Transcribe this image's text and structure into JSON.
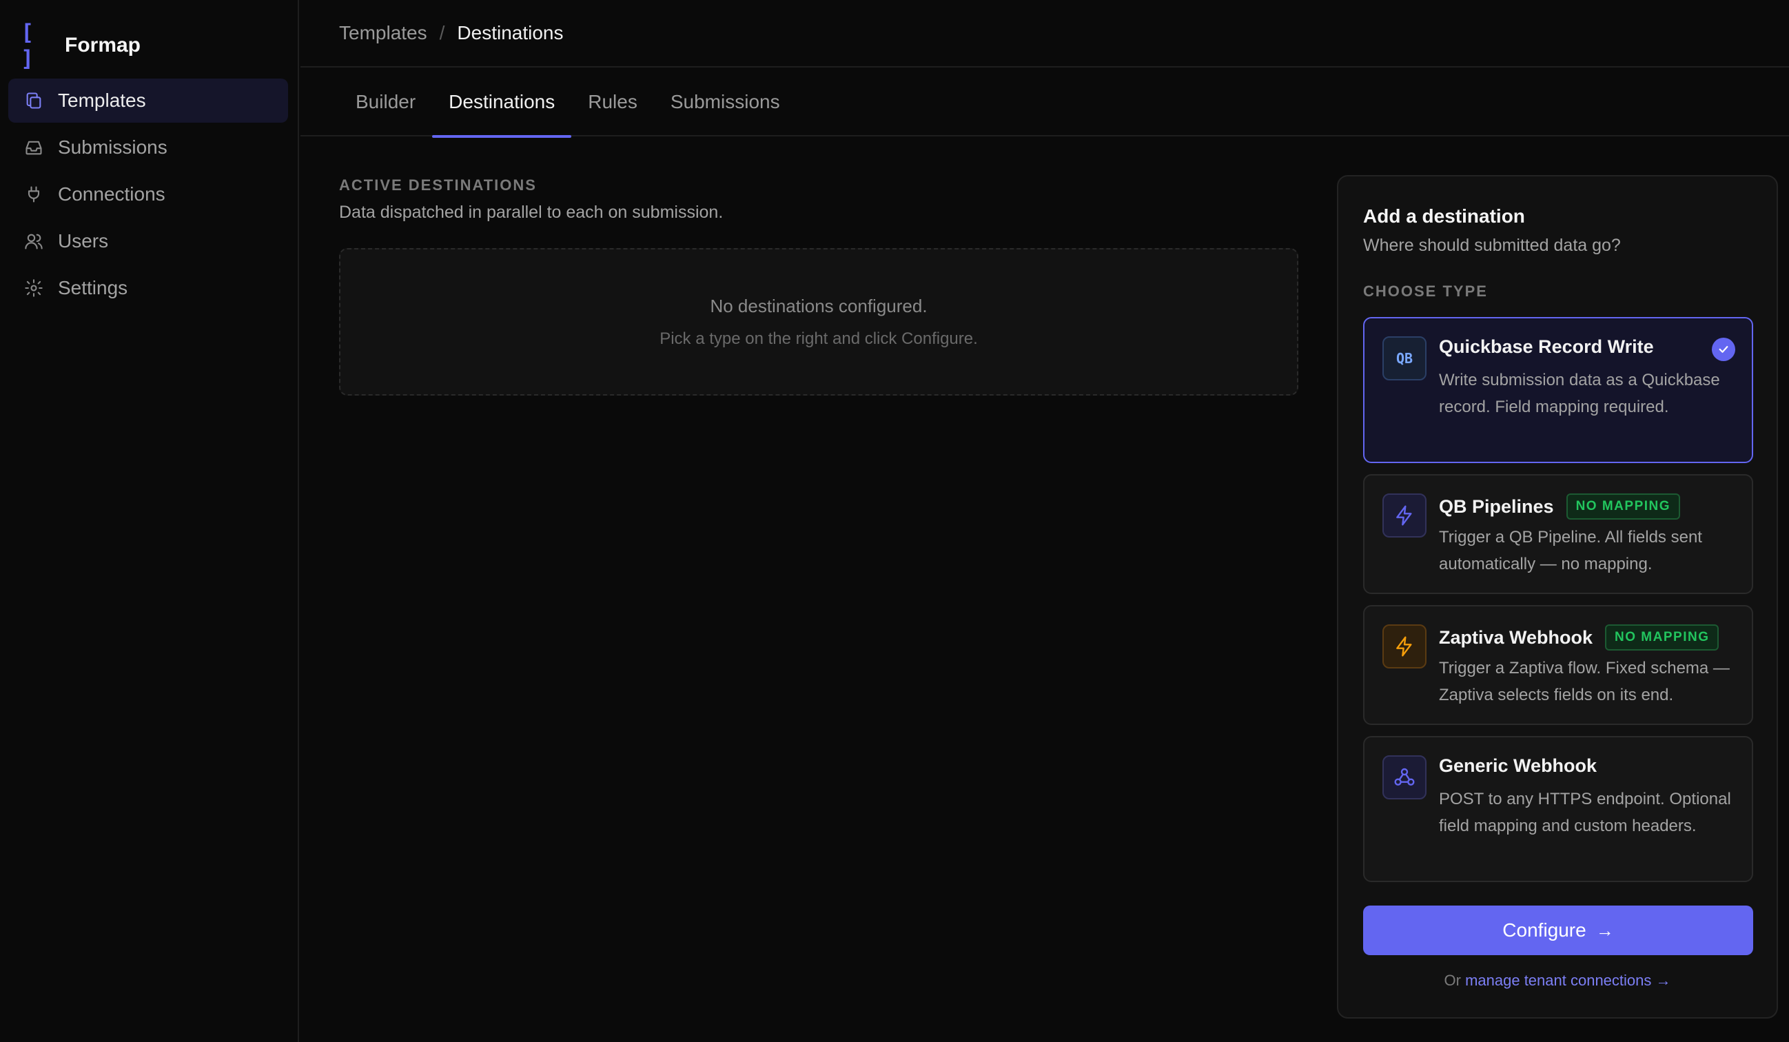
{
  "app": {
    "name": "Formap",
    "logo_mark": "[ ]"
  },
  "colors": {
    "accent": "#6366f1",
    "success": "#22c55e",
    "warning": "#f59e0b"
  },
  "sidebar": {
    "items": [
      {
        "label": "Templates",
        "icon": "copy-icon",
        "active": true
      },
      {
        "label": "Submissions",
        "icon": "inbox-icon"
      },
      {
        "label": "Connections",
        "icon": "plug-icon"
      },
      {
        "label": "Users",
        "icon": "users-icon"
      },
      {
        "label": "Settings",
        "icon": "gear-icon"
      }
    ]
  },
  "breadcrumb": {
    "parent": "Templates",
    "separator": "/",
    "current": "Destinations"
  },
  "tabs": [
    {
      "label": "Builder"
    },
    {
      "label": "Destinations",
      "active": true
    },
    {
      "label": "Rules"
    },
    {
      "label": "Submissions"
    }
  ],
  "active_destinations": {
    "label": "ACTIVE DESTINATIONS",
    "description": "Data dispatched in parallel to each on submission.",
    "empty_title": "No destinations configured.",
    "empty_hint": "Pick a type on the right and click Configure."
  },
  "panel": {
    "title": "Add a destination",
    "subtitle": "Where should submitted data go?",
    "choose_label": "CHOOSE TYPE",
    "options": [
      {
        "title": "Quickbase Record Write",
        "icon": "QB",
        "description": "Write submission data as a Quickbase record. Field mapping required.",
        "selected": true
      },
      {
        "title": "QB Pipelines",
        "icon": "bolt-icon",
        "badge": "NO MAPPING",
        "description": "Trigger a QB Pipeline. All fields sent automatically — no mapping."
      },
      {
        "title": "Zaptiva Webhook",
        "icon": "bolt-icon",
        "badge": "NO MAPPING",
        "description": "Trigger a Zaptiva flow. Fixed schema — Zaptiva selects fields on its end."
      },
      {
        "title": "Generic Webhook",
        "icon": "webhook-icon",
        "description": "POST to any HTTPS endpoint. Optional field mapping and custom headers."
      }
    ],
    "configure_label": "Configure",
    "configure_arrow": "→",
    "footer_prefix": "Or",
    "footer_link": "manage tenant connections →"
  }
}
